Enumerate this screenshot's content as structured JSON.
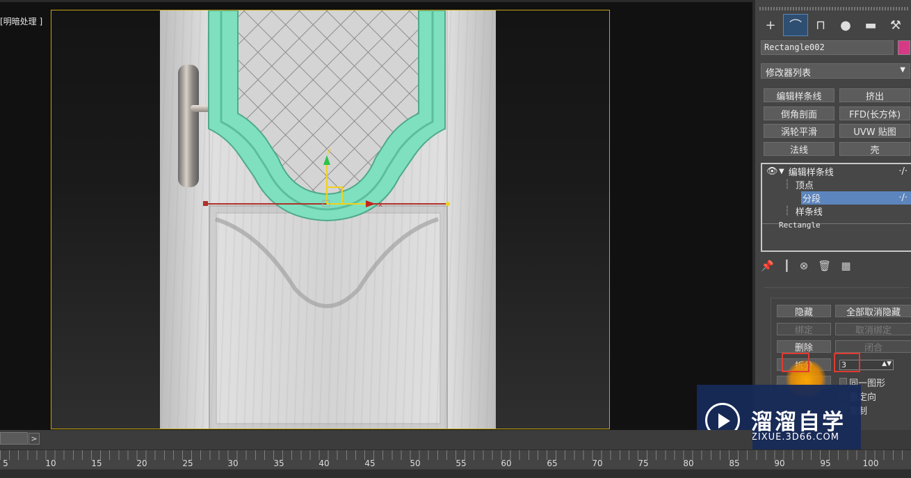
{
  "viewport": {
    "label": "[明暗处理 ]",
    "gizmo_y": "y",
    "gizmo_x": "x",
    "colors": {
      "frame": "#c9a414",
      "molding": "#7ee0bf"
    }
  },
  "command_panel": {
    "tabs": [
      {
        "icon": "plus-icon",
        "glyph": "+"
      },
      {
        "icon": "modify-icon",
        "glyph": "⌒"
      },
      {
        "icon": "hierarchy-icon",
        "glyph": "⊓"
      },
      {
        "icon": "motion-icon",
        "glyph": "●"
      },
      {
        "icon": "display-icon",
        "glyph": "▬"
      },
      {
        "icon": "utilities-icon",
        "glyph": "⚒"
      }
    ],
    "object_name": "Rectangle002",
    "object_color": "#d63a86",
    "modifier_list": "修改器列表",
    "modifier_buttons": [
      "编辑样条线",
      "挤出",
      "倒角剖面",
      "FFD(长方体)",
      "涡轮平滑",
      "UVW 贴图",
      "法线",
      "壳"
    ],
    "stack": {
      "modifier": "编辑样条线",
      "sub_objects": [
        "顶点",
        "分段",
        "样条线"
      ],
      "selected": "分段",
      "base": "Rectangle",
      "wire_marker": "·/·"
    },
    "stack_icons": [
      "pin-icon",
      "show-end-result-icon",
      "make-unique-icon",
      "remove-modifier-icon",
      "configure-icon"
    ],
    "rollout": {
      "hide": "隐藏",
      "unhide_all": "全部取消隐藏",
      "bind": "绑定",
      "unbind": "取消绑定",
      "delete": "删除",
      "close": "闭合",
      "divide": "拆分",
      "divide_value": "3",
      "detach": "分离",
      "same_shape": "同一图形",
      "reorient": "重定向",
      "copy": "复制"
    }
  },
  "watermark": {
    "title": "溜溜自学",
    "url": "ZIXUE.3D66.COM"
  },
  "timeline": {
    "next_label": ">",
    "ticks": [
      "5",
      "10",
      "15",
      "20",
      "25",
      "30",
      "35",
      "40",
      "45",
      "50",
      "55",
      "60",
      "65",
      "70",
      "75",
      "80",
      "85",
      "90",
      "95",
      "100"
    ]
  }
}
